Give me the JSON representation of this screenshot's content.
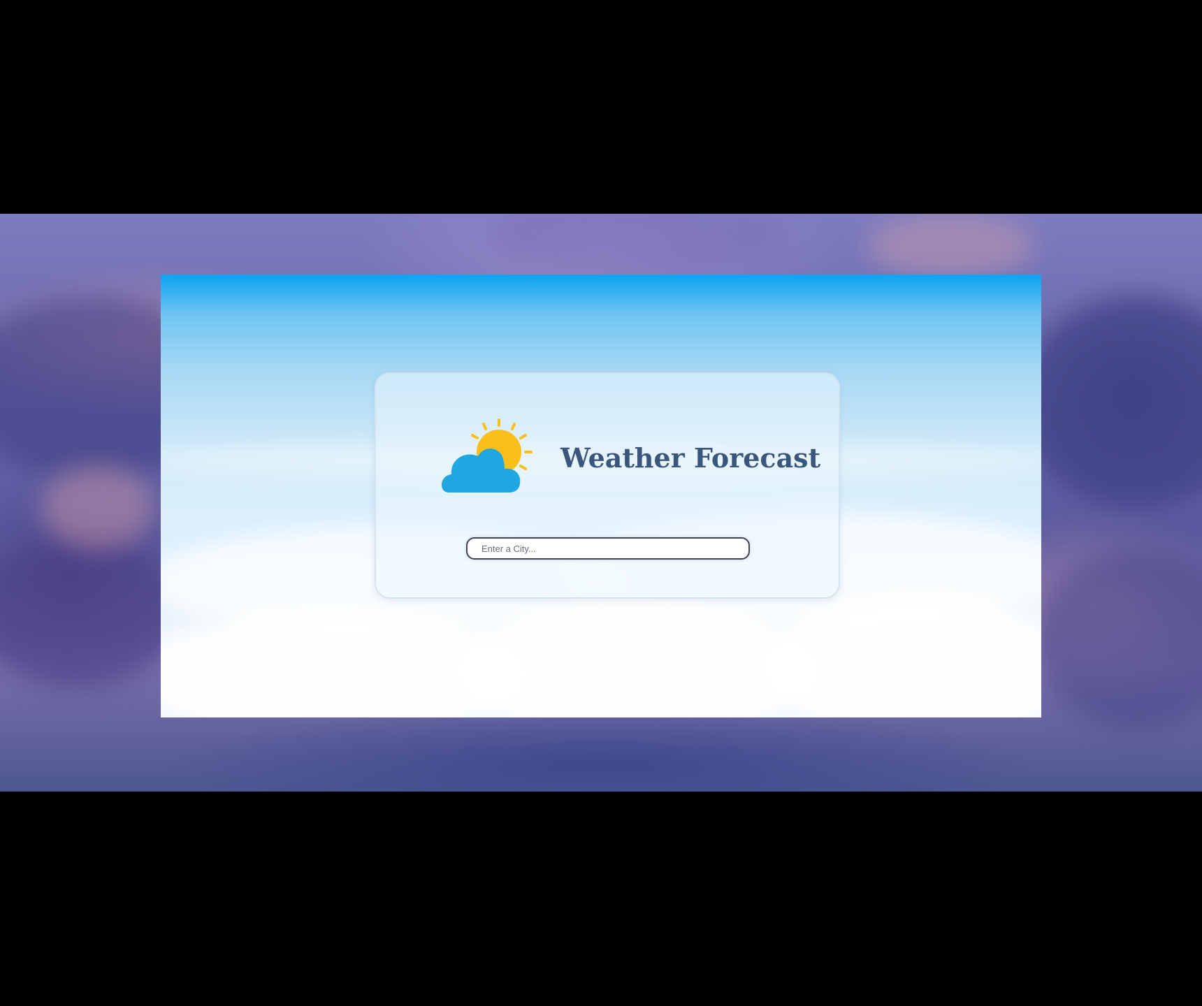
{
  "app": {
    "title": "Weather Forecast",
    "logo_icon": "partly-cloudy-sun-icon"
  },
  "search": {
    "placeholder": "Enter a City...",
    "value": ""
  },
  "colors": {
    "title": "#3a567c",
    "sun": "#fbbf1a",
    "cloud": "#1ea7e1",
    "input_border": "#3d4556"
  }
}
